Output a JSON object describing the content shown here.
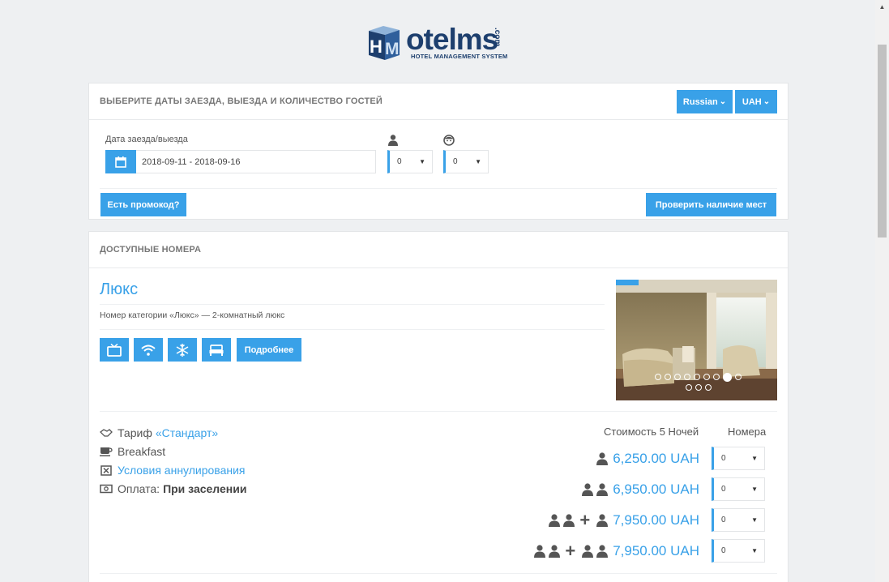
{
  "logo": {
    "letters": "HM",
    "word": "otelms",
    "com": ".com",
    "subtitle": "HOTEL MANAGEMENT SYSTEM"
  },
  "search_panel": {
    "title": "ВЫБЕРИТЕ ДАТЫ ЗАЕЗДА, ВЫЕЗДА И КОЛИЧЕСТВО ГОСТЕЙ",
    "language": "Russian",
    "currency": "UAH",
    "dates_label": "Дата заезда/выезда",
    "dates_value": "2018-09-11 - 2018-09-16",
    "adults_value": "0",
    "children_value": "0",
    "promo_button": "Есть промокод?",
    "check_button": "Проверить наличие мест"
  },
  "rooms_panel": {
    "title": "ДОСТУПНЫЕ НОМЕРА",
    "room": {
      "name": "Люкс",
      "description": "Номер категории «Люкс» — 2-комнатный люкс",
      "amenities": [
        "tv-icon",
        "wifi-icon",
        "snowflake-icon",
        "bed-icon"
      ],
      "more_button": "Подробнее",
      "photo_dots": 11,
      "active_dot": 8
    },
    "tariff": {
      "label": "Тариф",
      "name": "«Стандарт»",
      "meal": "Breakfast",
      "cancel_link": "Условия аннулирования",
      "payment_label": "Оплата:",
      "payment_value": "При заселении"
    },
    "cost_header": "Стоимость 5 Ночей",
    "rooms_header": "Номера",
    "prices": [
      {
        "occupancy": "1 adult",
        "price": "6,250.00 UAH",
        "qty": "0"
      },
      {
        "occupancy": "2 adults",
        "price": "6,950.00 UAH",
        "qty": "0"
      },
      {
        "occupancy": "2 adults + 1 extra",
        "price": "7,950.00 UAH",
        "qty": "0"
      },
      {
        "occupancy": "2 adults + 2 extra",
        "price": "7,950.00 UAH",
        "qty": "0"
      }
    ]
  },
  "colors": {
    "accent": "#39a1e8",
    "logo_navy": "#1d3f6e",
    "background": "#eef0f2"
  }
}
